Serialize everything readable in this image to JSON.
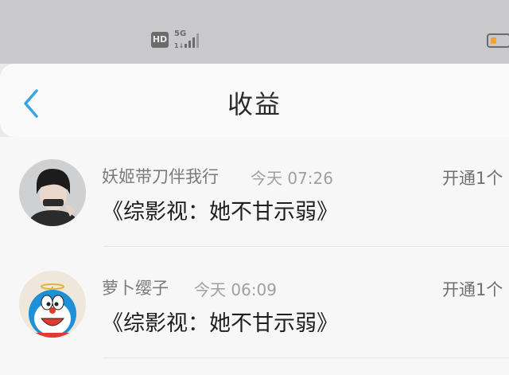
{
  "status_bar": {
    "hd_label": "HD",
    "network_label": "5G",
    "icons": [
      "hd-icon",
      "signal-icon",
      "battery-icon"
    ],
    "battery_color": "#f4a62a"
  },
  "header": {
    "back_icon": "chevron-left-icon",
    "title": "收益",
    "accent_color": "#3aa3e3"
  },
  "feed": [
    {
      "avatar": "avatar-photo",
      "username": "妖姬带刀伴我行",
      "time": "今天 07:26",
      "action": "开通1个",
      "content": "《综影视：她不甘示弱》"
    },
    {
      "avatar": "avatar-doraemon",
      "username": "萝卜缨子",
      "time": "今天 06:09",
      "action": "开通1个",
      "content": "《综影视：她不甘示弱》"
    }
  ]
}
